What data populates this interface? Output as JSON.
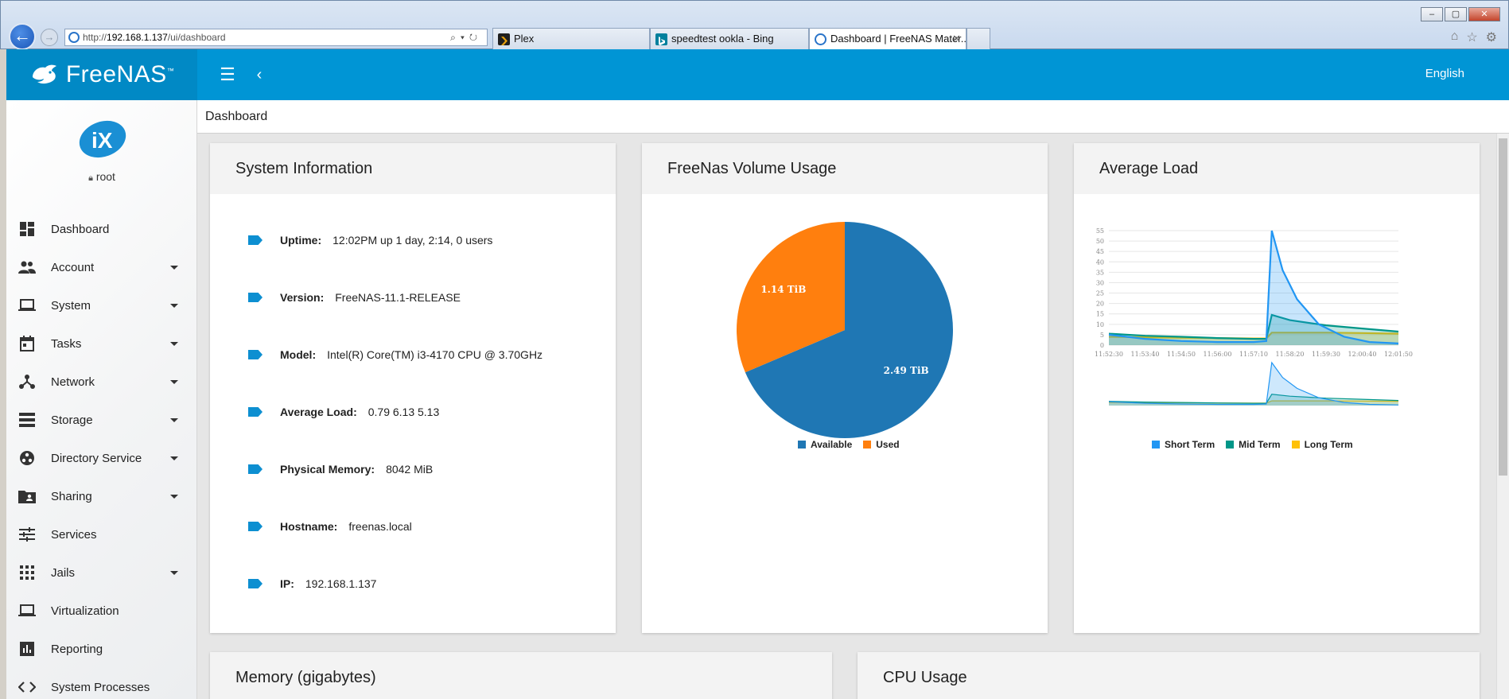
{
  "browser": {
    "url_prefix": "http://",
    "url_host": "192.168.1.137",
    "url_path": "/ui/dashboard",
    "tabs": [
      {
        "label": "Plex",
        "color": "#1f1f1f"
      },
      {
        "label": "speedtest ookla - Bing",
        "color": "#00809d"
      },
      {
        "label": "Dashboard | FreeNAS Mater...",
        "color": "#2a74c9"
      }
    ],
    "tab_close": "✕",
    "controls": {
      "minimize": "–",
      "maximize": "▢",
      "close": "✕"
    }
  },
  "header": {
    "brand": "FreeNAS",
    "brand_tm": "™",
    "language": "English"
  },
  "sidebar": {
    "user": "root",
    "items": [
      {
        "label": "Dashboard",
        "icon": "dashboard-icon",
        "expandable": false
      },
      {
        "label": "Account",
        "icon": "people-icon",
        "expandable": true
      },
      {
        "label": "System",
        "icon": "laptop-icon",
        "expandable": true
      },
      {
        "label": "Tasks",
        "icon": "calendar-icon",
        "expandable": true
      },
      {
        "label": "Network",
        "icon": "network-icon",
        "expandable": true
      },
      {
        "label": "Storage",
        "icon": "storage-icon",
        "expandable": true
      },
      {
        "label": "Directory Service",
        "icon": "directory-icon",
        "expandable": true
      },
      {
        "label": "Sharing",
        "icon": "folder-shared-icon",
        "expandable": true
      },
      {
        "label": "Services",
        "icon": "tune-icon",
        "expandable": false
      },
      {
        "label": "Jails",
        "icon": "apps-icon",
        "expandable": true
      },
      {
        "label": "Virtualization",
        "icon": "laptop-icon",
        "expandable": false
      },
      {
        "label": "Reporting",
        "icon": "insert-chart-icon",
        "expandable": false
      },
      {
        "label": "System Processes",
        "icon": "code-icon",
        "expandable": false
      }
    ]
  },
  "page": {
    "title": "Dashboard"
  },
  "system_info": {
    "title": "System Information",
    "rows": [
      {
        "key": "Uptime:",
        "value": "12:02PM up 1 day, 2:14, 0 users"
      },
      {
        "key": "Version:",
        "value": "FreeNAS-11.1-RELEASE"
      },
      {
        "key": "Model:",
        "value": "Intel(R) Core(TM) i3-4170 CPU @ 3.70GHz"
      },
      {
        "key": "Average Load:",
        "value": "0.79 6.13 5.13"
      },
      {
        "key": "Physical Memory:",
        "value": "8042 MiB"
      },
      {
        "key": "Hostname:",
        "value": "freenas.local"
      },
      {
        "key": "IP:",
        "value": "192.168.1.137"
      }
    ]
  },
  "volume_card": {
    "title": "FreeNas Volume Usage"
  },
  "load_card": {
    "title": "Average Load"
  },
  "memory_card": {
    "title": "Memory (gigabytes)"
  },
  "cpu_card": {
    "title": "CPU Usage"
  },
  "colors": {
    "accent": "#0095d5",
    "available": "#1f77b4",
    "used": "#ff7f0e",
    "short_term": "#2196f3",
    "mid_term": "#009688",
    "long_term": "#ffc107"
  },
  "chart_data": [
    {
      "type": "pie",
      "labels": [
        "Available",
        "Used"
      ],
      "values": [
        2.49,
        1.14
      ],
      "value_labels": [
        "2.49 TiB",
        "1.14 TiB"
      ],
      "colors": [
        "#1f77b4",
        "#ff7f0e"
      ],
      "legend": "bottom"
    },
    {
      "type": "area",
      "x": [
        "11:52:30",
        "11:53:40",
        "11:54:50",
        "11:56:00",
        "11:57:10",
        "11:58:20",
        "11:59:30",
        "12:00:40",
        "12:01:50"
      ],
      "ylim": [
        0,
        55
      ],
      "yticks": [
        0,
        5,
        10,
        15,
        20,
        25,
        30,
        35,
        40,
        45,
        50,
        55
      ],
      "grid": true,
      "legend": "bottom",
      "series": [
        {
          "name": "Short Term",
          "color": "#2196f3",
          "points": [
            [
              0,
              5
            ],
            [
              1,
              3
            ],
            [
              2,
              2
            ],
            [
              3,
              1.5
            ],
            [
              4,
              1.5
            ],
            [
              4.35,
              2
            ],
            [
              4.5,
              55
            ],
            [
              4.8,
              36
            ],
            [
              5.2,
              22
            ],
            [
              5.8,
              10
            ],
            [
              6.5,
              4
            ],
            [
              7.2,
              1.5
            ],
            [
              8,
              0.8
            ]
          ]
        },
        {
          "name": "Mid Term",
          "color": "#009688",
          "points": [
            [
              0,
              5.5
            ],
            [
              1,
              4.5
            ],
            [
              2,
              4
            ],
            [
              3,
              3.4
            ],
            [
              4,
              3
            ],
            [
              4.35,
              3
            ],
            [
              4.5,
              14.5
            ],
            [
              5,
              12
            ],
            [
              6,
              9.5
            ],
            [
              7,
              8
            ],
            [
              8,
              6.5
            ]
          ]
        },
        {
          "name": "Long Term",
          "color": "#ffc107",
          "points": [
            [
              0,
              4
            ],
            [
              1,
              3.8
            ],
            [
              2,
              3.6
            ],
            [
              3,
              3.4
            ],
            [
              4,
              3.2
            ],
            [
              4.35,
              3.2
            ],
            [
              4.5,
              6
            ],
            [
              5,
              6
            ],
            [
              6,
              6
            ],
            [
              7,
              5.8
            ],
            [
              8,
              5.5
            ]
          ]
        }
      ]
    }
  ]
}
